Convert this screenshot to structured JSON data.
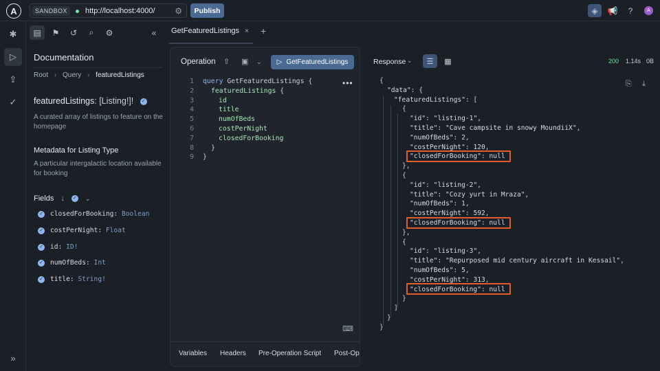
{
  "topbar": {
    "logo": "A",
    "sandbox_label": "SANDBOX",
    "url": "http://localhost:4000/",
    "publish_label": "Publish"
  },
  "docs": {
    "title": "Documentation",
    "breadcrumb": [
      "Root",
      "Query",
      "featuredListings"
    ],
    "field_name": "featuredListings",
    "field_type": ": [Listing!]!",
    "field_desc": "A curated array of listings to feature on the homepage",
    "meta_title": "Metadata for Listing Type",
    "meta_desc": "A particular intergalactic location available for booking",
    "fields_label": "Fields",
    "fields": [
      {
        "name": "closedForBooking",
        "type": "Boolean"
      },
      {
        "name": "costPerNight",
        "type": "Float"
      },
      {
        "name": "id",
        "type": "ID!"
      },
      {
        "name": "numOfBeds",
        "type": "Int"
      },
      {
        "name": "title",
        "type": "String!"
      }
    ]
  },
  "editor": {
    "tab_label": "GetFeaturedListings",
    "operation_label": "Operation",
    "run_label": "GetFeaturedListings",
    "lines": [
      {
        "n": "1",
        "text": "query GetFeaturedListings {"
      },
      {
        "n": "2",
        "text": "featuredListings {"
      },
      {
        "n": "3",
        "text": "id"
      },
      {
        "n": "4",
        "text": "title"
      },
      {
        "n": "5",
        "text": "numOfBeds"
      },
      {
        "n": "6",
        "text": "costPerNight"
      },
      {
        "n": "7",
        "text": "closedForBooking"
      },
      {
        "n": "8",
        "text": "}"
      },
      {
        "n": "9",
        "text": "}"
      }
    ],
    "bottom_tabs": [
      "Variables",
      "Headers",
      "Pre-Operation Script",
      "Post-Operation Script"
    ]
  },
  "response": {
    "label": "Response",
    "status": "200",
    "time": "1.14s",
    "size": "0B",
    "listings": [
      {
        "id": "listing-1",
        "title": "Cave campsite in snowy MoundiiX",
        "numOfBeds": "2",
        "costPerNight": "120",
        "closedForBooking": "null"
      },
      {
        "id": "listing-2",
        "title": "Cozy yurt in Mraza",
        "numOfBeds": "1",
        "costPerNight": "592",
        "closedForBooking": "null"
      },
      {
        "id": "listing-3",
        "title": "Repurposed mid century aircraft in Kessail",
        "numOfBeds": "5",
        "costPerNight": "313",
        "closedForBooking": "null"
      }
    ]
  },
  "colors": {
    "accent": "#4b6a93",
    "highlight": "#e0602a",
    "success": "#7adfa4"
  }
}
